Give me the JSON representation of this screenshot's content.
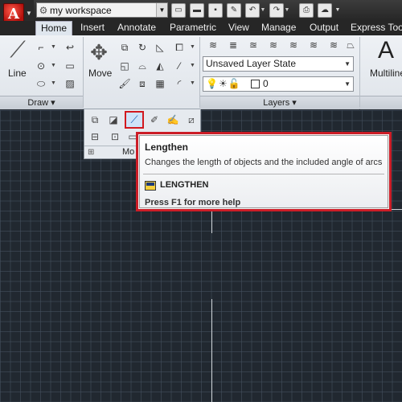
{
  "app": {
    "logo_letter": "A",
    "workspace": "my workspace",
    "brand_color": "#cc1d27"
  },
  "quick_access": [
    "new-icon",
    "open-icon",
    "save-icon",
    "save-as-icon",
    "undo-icon",
    "redo-icon",
    "print-icon",
    "cloud-icon"
  ],
  "tabs": [
    {
      "label": "Home",
      "active": true
    },
    {
      "label": "Insert"
    },
    {
      "label": "Annotate"
    },
    {
      "label": "Parametric"
    },
    {
      "label": "View"
    },
    {
      "label": "Manage"
    },
    {
      "label": "Output"
    },
    {
      "label": "Express Tool"
    }
  ],
  "ribbon": {
    "draw": {
      "line_label": "Line",
      "panel_title": "Draw ▾"
    },
    "modify": {
      "move_label": "Move",
      "panel_title": "Mo"
    },
    "layers": {
      "layer_state": "Unsaved Layer State",
      "current_layer": "0",
      "panel_title": "Layers ▾"
    },
    "annotation": {
      "multiline_label": "Multiline",
      "big_letter": "A"
    }
  },
  "tooltip": {
    "title": "Lengthen",
    "description": "Changes the length of objects and the included angle of arcs",
    "command": "LENGTHEN",
    "help": "Press F1 for more help",
    "highlight_color": "#cc1d27"
  },
  "canvas": {
    "background": "#212830"
  }
}
